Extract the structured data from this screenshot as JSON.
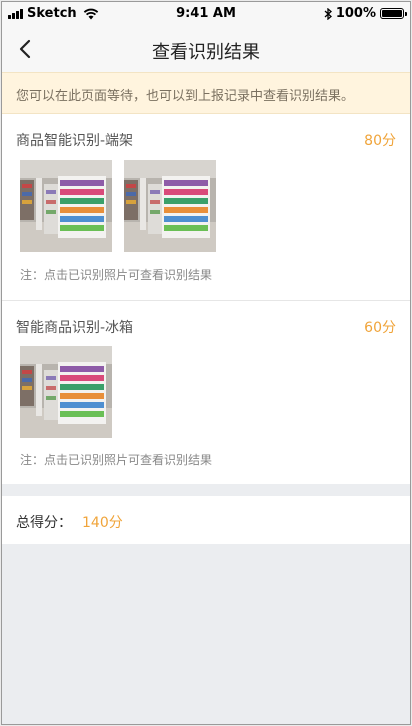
{
  "status_bar": {
    "carrier": "Sketch",
    "time": "9:41 AM",
    "battery": "100%"
  },
  "nav": {
    "title": "查看识别结果"
  },
  "notice": {
    "text": "您可以在此页面等待，也可以到上报记录中查看识别结果。"
  },
  "sections": [
    {
      "title": "商品智能识别-端架",
      "score": "80分",
      "photo_count": 2,
      "note": "注：点击已识别照片可查看识别结果"
    },
    {
      "title": "智能商品识别-冰箱",
      "score": "60分",
      "photo_count": 1,
      "note": "注：点击已识别照片可查看识别结果"
    }
  ],
  "total": {
    "label": "总得分：",
    "value": "140分"
  },
  "colors": {
    "accent": "#f0a43a",
    "notice_bg": "#fff4de",
    "page_bg": "#ebedf0"
  }
}
